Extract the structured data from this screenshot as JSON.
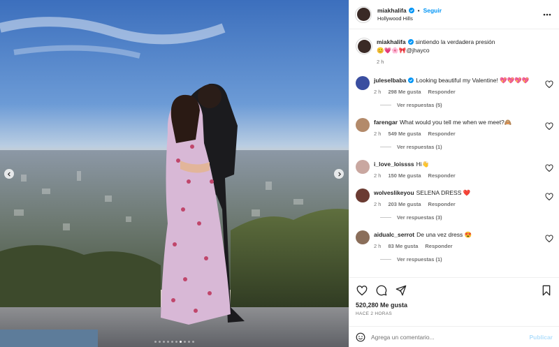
{
  "post": {
    "image_alt": "Pareja abrazándose en un mirador con vista a la ciudad",
    "carousel_dots": 10,
    "active_dot": 6
  },
  "header": {
    "username": "miakhalifa",
    "separator": "•",
    "follow_label": "Seguir",
    "location": "Hollywood Hills"
  },
  "caption": {
    "username": "miakhalifa",
    "text": "sintiendo la verdadera presión",
    "emojis": "😊💗🌸🎀",
    "mention": "@jhayco",
    "time": "2 h"
  },
  "comments": [
    {
      "username": "juleselbaba",
      "verified": true,
      "text": "Looking beautiful my Valentine! 💖💖💖💖",
      "time": "2 h",
      "likes": "298 Me gusta",
      "reply": "Responder",
      "replies": "Ver respuestas (5)",
      "avatar_color": "#3a4ea0"
    },
    {
      "username": "farengar",
      "verified": false,
      "text": "What would you tell me when we meet?🙈",
      "time": "2 h",
      "likes": "549 Me gusta",
      "reply": "Responder",
      "replies": "Ver respuestas (1)",
      "avatar_color": "#b38a6a"
    },
    {
      "username": "i_love_loissss",
      "verified": false,
      "text": "Hi👋",
      "time": "2 h",
      "likes": "150 Me gusta",
      "reply": "Responder",
      "replies": "",
      "avatar_color": "#c9a7a0"
    },
    {
      "username": "wolveslikeyou",
      "verified": false,
      "text": "SELENA DRESS ❤️",
      "time": "2 h",
      "likes": "203 Me gusta",
      "reply": "Responder",
      "replies": "Ver respuestas (3)",
      "avatar_color": "#6b3b32"
    },
    {
      "username": "aidualc_serrot",
      "verified": false,
      "text": "De una vez dress 😍",
      "time": "2 h",
      "likes": "83 Me gusta",
      "reply": "Responder",
      "replies": "Ver respuestas (1)",
      "avatar_color": "#8a6e5a"
    }
  ],
  "stats": {
    "likes": "520,280 Me gusta",
    "time_ago": "HACE 2 HORAS"
  },
  "composer": {
    "placeholder": "Agrega un comentario...",
    "publish_label": "Publicar"
  },
  "colors": {
    "accent": "#0095f6",
    "verified": "#0095f6",
    "muted": "#737373"
  },
  "icons": [
    "chevron-left-icon",
    "chevron-right-icon",
    "verified-icon",
    "more-icon",
    "heart-icon",
    "comment-icon",
    "share-icon",
    "bookmark-icon",
    "emoji-icon"
  ]
}
